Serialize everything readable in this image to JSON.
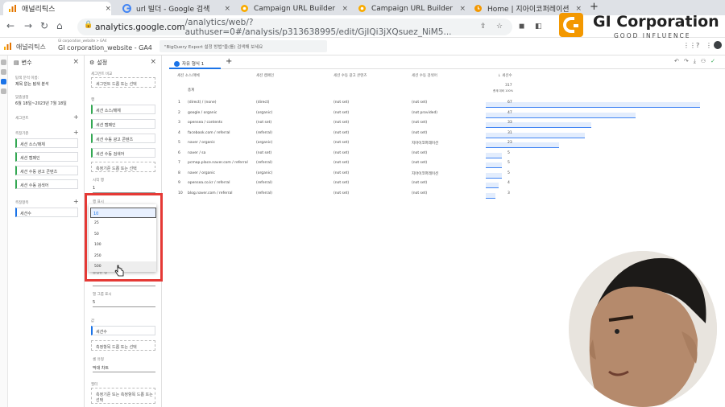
{
  "browser": {
    "tabs": [
      {
        "title": "애널리틱스",
        "icon": "analytics-tab-icon",
        "active": true
      },
      {
        "title": "url 빌더 - Google 검색",
        "icon": "google-g-icon"
      },
      {
        "title": "Campaign URL Builder",
        "icon": "gear-orange-icon"
      },
      {
        "title": "Campaign URL Builder",
        "icon": "gear-orange-icon"
      },
      {
        "title": "Home | 지아이코퍼레이션",
        "icon": "clock-orange-icon"
      }
    ],
    "close_glyph": "×",
    "new_tab_glyph": "+",
    "url_host": "analytics.google.com",
    "url_path": "/analytics/web/?authuser=0#/analysis/p313638995/edit/GjIQi3jXQsuez_NiM5..."
  },
  "ga": {
    "product": "애널리틱스",
    "account": "GI corporation_website > GA4",
    "property": "GI corporation_website - GA4",
    "search_placeholder": "\"BigQuery Export 설정 방법\"을(를) 검색해 보세요"
  },
  "logo": {
    "name": "GI Corporation",
    "tagline": "GOOD INFLUENCE"
  },
  "variables": {
    "title": "변수",
    "name_label": "탐색 분석 이름:",
    "name_value": "제목 없는 탐색 분석",
    "date_label": "맞춤설정",
    "date_value": "6월 18일~2023년 7월 18일",
    "segments_label": "세그먼트",
    "dims_label": "측정기준",
    "dims": [
      "세션 소스/매체",
      "세션 캠페인",
      "세션 수동 광고 콘텐츠",
      "세션 수동 검색어"
    ],
    "metrics_label": "측정항목",
    "metrics": [
      "세션수"
    ]
  },
  "settings": {
    "title": "설정",
    "seg_compare_label": "세그먼트 비교",
    "seg_drop": "세그먼트 드롭 또는 선택",
    "rows_label": "행",
    "rows": [
      "세션 소스/매체",
      "세션 캠페인",
      "세션 수동 광고 콘텐츠",
      "세션 수동 검색어"
    ],
    "dim_drop": "측정기준 드롭 또는 선택",
    "start_row_label": "시작 행",
    "start_row": "1",
    "show_rows_label": "행 표시",
    "nested_label": "중첩된 행",
    "cols_label": "열 그룹 표시",
    "cols_value": "5",
    "values_label": "값",
    "values": [
      "세션수"
    ],
    "metric_drop": "측정항목 드롭 또는 선택",
    "cell_type_label": "셀 유형",
    "cell_type_value": "막대 차트",
    "filter_label": "필터",
    "filter_drop": "측정기준 또는 측정항목 드롭 또는 선택"
  },
  "dropdown": {
    "options": [
      "10",
      "25",
      "50",
      "100",
      "250",
      "500"
    ],
    "selected": "10"
  },
  "report": {
    "tab": "자유 형식 1",
    "headers": [
      "세션 소스/매체",
      "세션 캠페인",
      "세션 수동 광고 콘텐츠",
      "세션 수동 검색어",
      "↓ 세션수"
    ],
    "total_label": "총계",
    "total": "317",
    "total_sub": "총계 대비 100%",
    "rows": [
      {
        "n": "1",
        "src": "(direct) / (none)",
        "camp": "(direct)",
        "content": "(not set)",
        "term": "(not set)",
        "sessions": 67
      },
      {
        "n": "2",
        "src": "google / organic",
        "camp": "(organic)",
        "content": "(not set)",
        "term": "(not provided)",
        "sessions": 47
      },
      {
        "n": "3",
        "src": "opensea / contents",
        "camp": "(not set)",
        "content": "(not set)",
        "term": "(not set)",
        "sessions": 33
      },
      {
        "n": "4",
        "src": "facebook.com / referral",
        "camp": "(referral)",
        "content": "(not set)",
        "term": "(not set)",
        "sessions": 31
      },
      {
        "n": "5",
        "src": "naver / organic",
        "camp": "(organic)",
        "content": "(not set)",
        "term": "지아이코퍼레이션",
        "sessions": 23
      },
      {
        "n": "6",
        "src": "naver / sa",
        "camp": "(not set)",
        "content": "(not set)",
        "term": "(not set)",
        "sessions": 5
      },
      {
        "n": "7",
        "src": "pcmap.place.naver.com / referral",
        "camp": "(referral)",
        "content": "(not set)",
        "term": "(not set)",
        "sessions": 5
      },
      {
        "n": "8",
        "src": "naver / organic",
        "camp": "(organic)",
        "content": "(not set)",
        "term": "지아이코퍼레이션",
        "sessions": 5
      },
      {
        "n": "9",
        "src": "opensea.co.kr / referral",
        "camp": "(referral)",
        "content": "(not set)",
        "term": "(not set)",
        "sessions": 4
      },
      {
        "n": "10",
        "src": "blog.naver.com / referral",
        "camp": "(referral)",
        "content": "(not set)",
        "term": "(not set)",
        "sessions": 3
      }
    ]
  },
  "colors": {
    "accent": "#1a73e8",
    "highlight": "#e53935",
    "brand": "#f39800"
  }
}
